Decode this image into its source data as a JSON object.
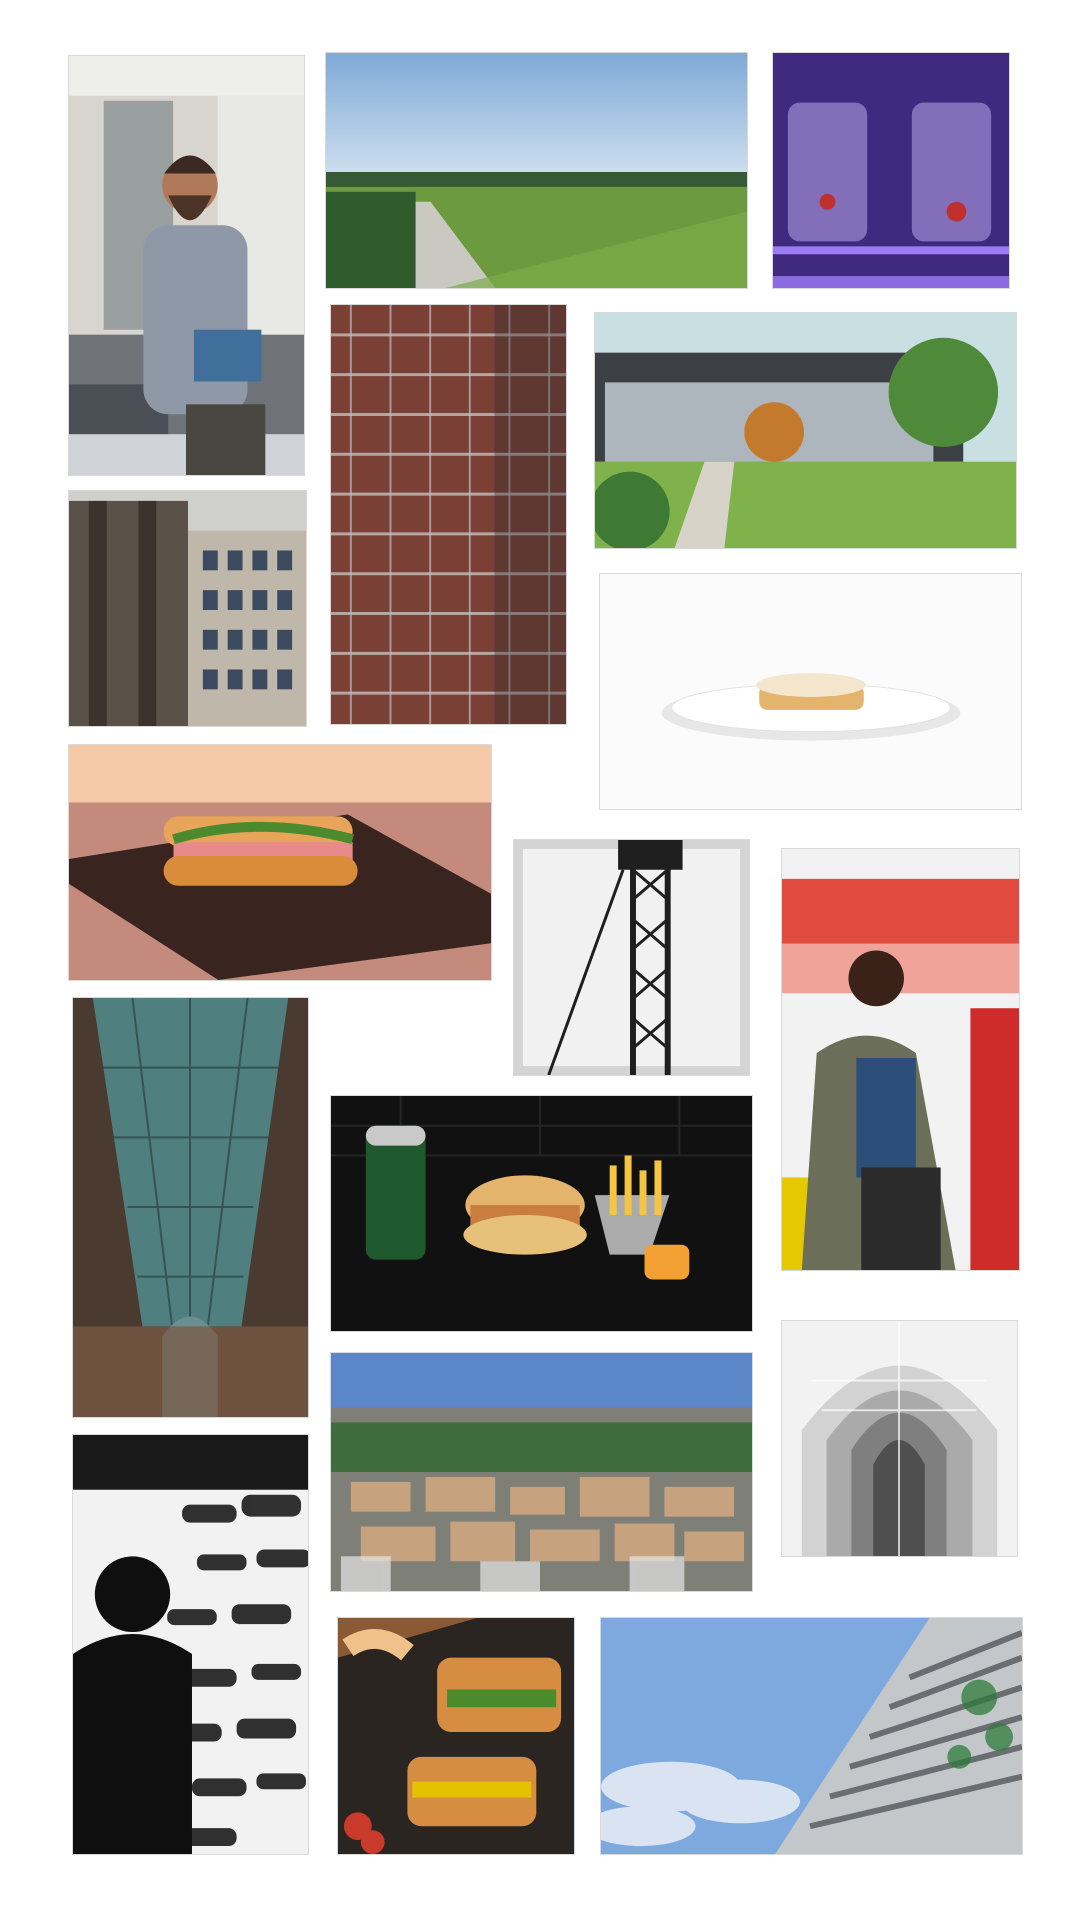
{
  "gallery": {
    "photos": [
      {
        "subject": "man-holding-circuit-board"
      },
      {
        "subject": "vineyard-aerial-landscape"
      },
      {
        "subject": "glass-jars-purple-light"
      },
      {
        "subject": "abandoned-building-frame"
      },
      {
        "subject": "scaffolded-brick-tower"
      },
      {
        "subject": "modern-building-garden"
      },
      {
        "subject": "tart-on-white-plate"
      },
      {
        "subject": "sandwich-on-slate"
      },
      {
        "subject": "crane-tower-bw"
      },
      {
        "subject": "man-at-market-stall"
      },
      {
        "subject": "glass-arcade-ceiling"
      },
      {
        "subject": "burger-fries-soda"
      },
      {
        "subject": "city-aerial-view"
      },
      {
        "subject": "gothic-church-interior-bw"
      },
      {
        "subject": "man-silhouette-car-wall"
      },
      {
        "subject": "panini-sandwiches-board"
      },
      {
        "subject": "modern-apartment-balconies"
      }
    ]
  },
  "colors": {
    "background": "#ffffff",
    "border": "#d9d9d9"
  }
}
